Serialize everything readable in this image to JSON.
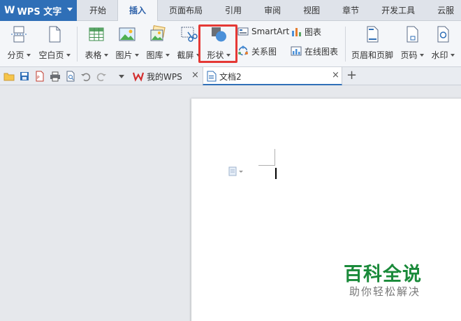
{
  "app": {
    "logo_glyph": "W",
    "name": "WPS 文字"
  },
  "menu_tabs": [
    {
      "label": "开始"
    },
    {
      "label": "插入"
    },
    {
      "label": "页面布局"
    },
    {
      "label": "引用"
    },
    {
      "label": "审阅"
    },
    {
      "label": "视图"
    },
    {
      "label": "章节"
    },
    {
      "label": "开发工具"
    },
    {
      "label": "云服"
    }
  ],
  "active_tab": "插入",
  "ribbon": {
    "page_break": "分页",
    "blank_page": "空白页",
    "table": "表格",
    "picture": "图片",
    "gallery": "图库",
    "screenshot": "截屏",
    "shapes": "形状",
    "smartart": "SmartArt",
    "chart": "图表",
    "relation": "关系图",
    "online_chart": "在线图表",
    "header_footer": "页眉和页脚",
    "page_number": "页码",
    "watermark": "水印"
  },
  "doc_tabs": {
    "my_wps": "我的WPS",
    "doc2": "文档2",
    "close_glyph": "×",
    "add_glyph": "+"
  },
  "watermark_brand": {
    "title": "百科全说",
    "subtitle": "助你轻松解决"
  },
  "colors": {
    "accent": "#2f6fb7",
    "highlight": "#e53935",
    "brand_green": "#1a8a3a"
  }
}
